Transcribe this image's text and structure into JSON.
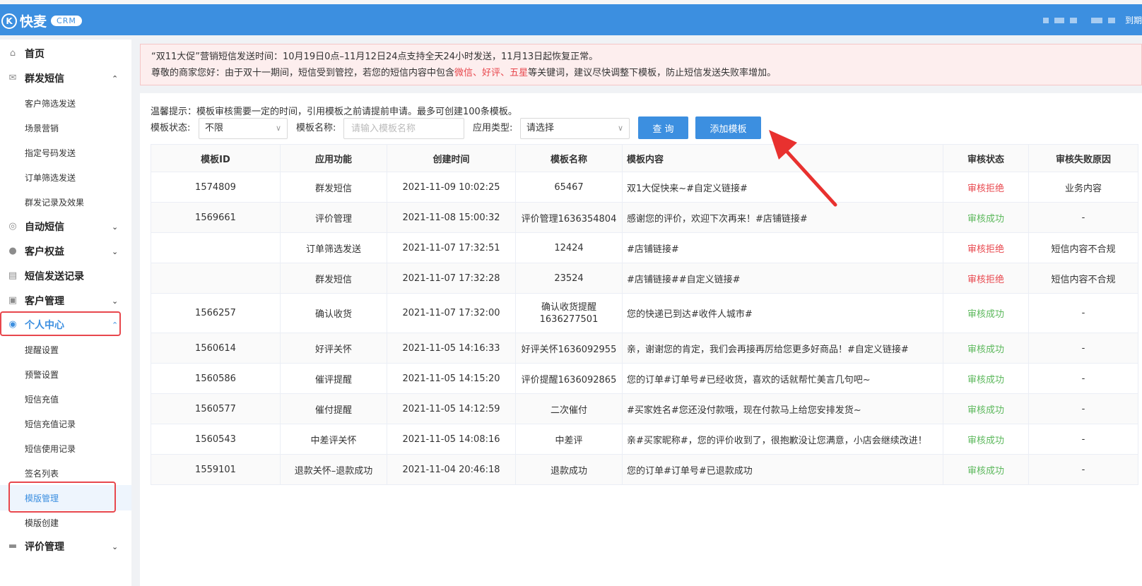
{
  "header": {
    "logo_mark": "K",
    "logo_text": "快麦",
    "logo_badge": "CRM",
    "right_text": "到期"
  },
  "sidebar": {
    "items": [
      {
        "label": "首页",
        "icon": "home-icon",
        "type": "top"
      },
      {
        "label": "群发短信",
        "icon": "mail-icon",
        "type": "top",
        "chevron": "⌃"
      },
      {
        "label": "客户筛选发送",
        "type": "sub"
      },
      {
        "label": "场景营销",
        "type": "sub"
      },
      {
        "label": "指定号码发送",
        "type": "sub"
      },
      {
        "label": "订单筛选发送",
        "type": "sub"
      },
      {
        "label": "群发记录及效果",
        "type": "sub"
      },
      {
        "label": "自动短信",
        "icon": "auto-sms-icon",
        "type": "top",
        "chevron": "⌄"
      },
      {
        "label": "客户权益",
        "icon": "user-icon",
        "type": "top",
        "chevron": "⌄"
      },
      {
        "label": "短信发送记录",
        "icon": "record-icon",
        "type": "top"
      },
      {
        "label": "客户管理",
        "icon": "card-icon",
        "type": "top",
        "chevron": "⌄"
      },
      {
        "label": "个人中心",
        "icon": "person-circle-icon",
        "type": "top",
        "chevron": "⌃"
      },
      {
        "label": "提醒设置",
        "type": "sub"
      },
      {
        "label": "预警设置",
        "type": "sub"
      },
      {
        "label": "短信充值",
        "type": "sub"
      },
      {
        "label": "短信充值记录",
        "type": "sub"
      },
      {
        "label": "短信使用记录",
        "type": "sub"
      },
      {
        "label": "签名列表",
        "type": "sub"
      },
      {
        "label": "模版管理",
        "type": "sub"
      },
      {
        "label": "模版创建",
        "type": "sub"
      },
      {
        "label": "评价管理",
        "icon": "comment-icon",
        "type": "top",
        "chevron": "⌄"
      }
    ]
  },
  "notice": {
    "line1": "“双11大促”营销短信发送时间：10月19日0点–11月12日24点支持全天24小时发送，11月13日起恢复正常。",
    "line2_a": "尊敬的商家您好：由于双十一期间，短信受到管控，若您的短信内容中包含",
    "kw1": "微信",
    "sep1": "、",
    "kw2": "好评",
    "sep2": "、",
    "kw3": "五星",
    "line2_b": "等关键词，建议尽快调整下模板，防止短信发送失败率增加。"
  },
  "tip": "温馨提示：模板审核需要一定的时间，引用模板之前请提前申请。最多可创建100条模板。",
  "filters": {
    "status_label": "模板状态:",
    "status_value": "不限",
    "name_label": "模板名称:",
    "name_placeholder": "请输入模板名称",
    "type_label": "应用类型:",
    "type_value": "请选择",
    "query_btn": "查 询",
    "add_btn": "添加模板"
  },
  "table": {
    "headers": [
      "模板ID",
      "应用功能",
      "创建时间",
      "模板名称",
      "模板内容",
      "审核状态",
      "审核失败原因"
    ],
    "rows": [
      {
        "id": "1574809",
        "func": "群发短信",
        "time": "2021-11-09 10:02:25",
        "name": "65467",
        "content": "双1大促快来~#自定义链接#",
        "status": "审核拒绝",
        "reason": "业务内容"
      },
      {
        "id": "1569661",
        "func": "评价管理",
        "time": "2021-11-08 15:00:32",
        "name": "评价管理1636354804",
        "content": "感谢您的评价，欢迎下次再来！#店铺链接#",
        "status": "审核成功",
        "reason": "-"
      },
      {
        "id": "",
        "func": "订单筛选发送",
        "time": "2021-11-07 17:32:51",
        "name": "12424",
        "content": "#店铺链接#",
        "status": "审核拒绝",
        "reason": "短信内容不合规"
      },
      {
        "id": "",
        "func": "群发短信",
        "time": "2021-11-07 17:32:28",
        "name": "23524",
        "content": "#店铺链接##自定义链接#",
        "status": "审核拒绝",
        "reason": "短信内容不合规"
      },
      {
        "id": "1566257",
        "func": "确认收货",
        "time": "2021-11-07 17:32:00",
        "name": "确认收货提醒1636277501",
        "content": "您的快递已到达#收件人城市#",
        "status": "审核成功",
        "reason": "-"
      },
      {
        "id": "1560614",
        "func": "好评关怀",
        "time": "2021-11-05 14:16:33",
        "name": "好评关怀1636092955",
        "content": "亲，谢谢您的肯定，我们会再接再厉给您更多好商品！#自定义链接#",
        "status": "审核成功",
        "reason": "-"
      },
      {
        "id": "1560586",
        "func": "催评提醒",
        "time": "2021-11-05 14:15:20",
        "name": "评价提醒1636092865",
        "content": "您的订单#订单号#已经收货，喜欢的话就帮忙美言几句吧~",
        "status": "审核成功",
        "reason": "-"
      },
      {
        "id": "1560577",
        "func": "催付提醒",
        "time": "2021-11-05 14:12:59",
        "name": "二次催付",
        "content": "#买家姓名#您还没付款哦，现在付款马上给您安排发货~",
        "status": "审核成功",
        "reason": "-"
      },
      {
        "id": "1560543",
        "func": "中差评关怀",
        "time": "2021-11-05 14:08:16",
        "name": "中差评",
        "content": "亲#买家昵称#，您的评价收到了，很抱歉没让您满意，小店会继续改进！",
        "status": "审核成功",
        "reason": "-"
      },
      {
        "id": "1559101",
        "func": "退款关怀–退款成功",
        "time": "2021-11-04 20:46:18",
        "name": "退款成功",
        "content": "您的订单#订单号#已退款成功",
        "status": "审核成功",
        "reason": "-"
      }
    ]
  },
  "colors": {
    "primary": "#3c8fe0",
    "reject": "#e8474d",
    "success": "#5cb85c",
    "highlight_box": "#e8474d",
    "arrow": "#e8312f"
  }
}
